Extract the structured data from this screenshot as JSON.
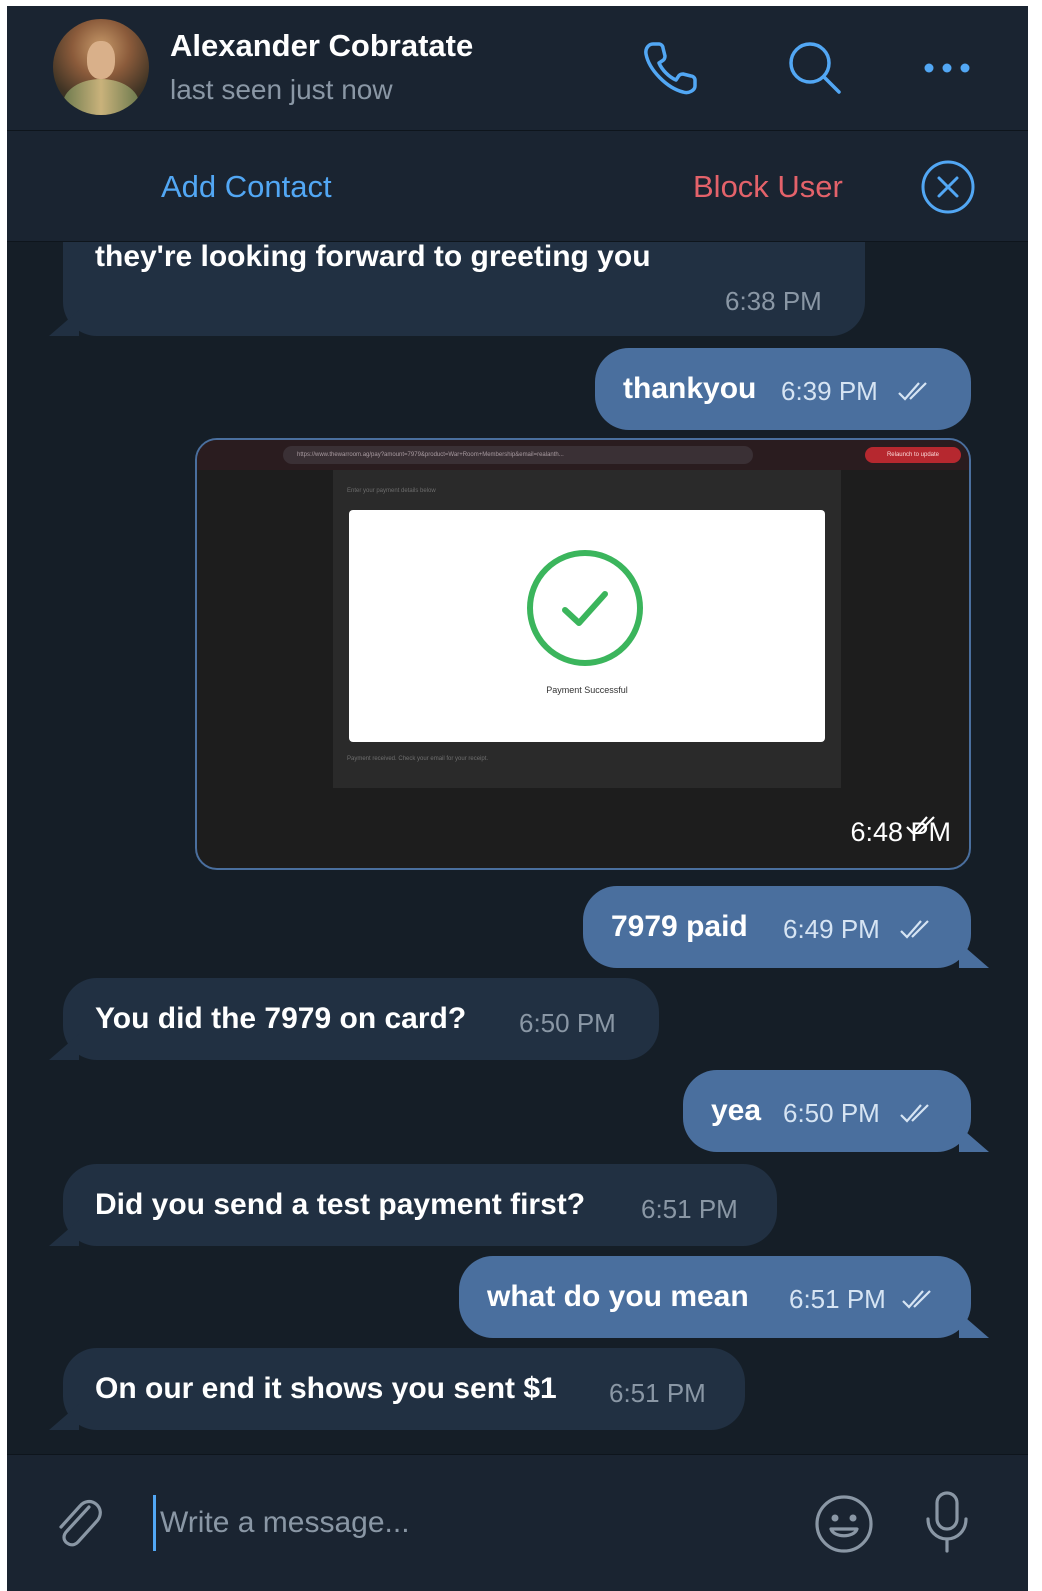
{
  "header": {
    "name": "Alexander Cobratate",
    "status": "last seen just now"
  },
  "actionbar": {
    "add_contact": "Add Contact",
    "block_user": "Block User"
  },
  "messages": [
    {
      "dir": "in",
      "text": "they're looking forward to greeting you",
      "time": "6:38 PM"
    },
    {
      "dir": "out",
      "text": "thankyou",
      "time": "6:39 PM"
    },
    {
      "dir": "out",
      "type": "image",
      "time": "6:48 PM",
      "image": {
        "url": "https://www.thewarroom.ag/pay?amount=7979&product=War+Room+Membership&email=realanth...",
        "relaunch": "Relaunch to update",
        "top_text": "Enter your payment details below",
        "card_text": "Payment Successful",
        "bottom_text": "Payment received. Check your email for your receipt."
      }
    },
    {
      "dir": "out",
      "text": "7979 paid",
      "time": "6:49 PM"
    },
    {
      "dir": "in",
      "text": "You did the 7979 on card?",
      "time": "6:50 PM"
    },
    {
      "dir": "out",
      "text": "yea",
      "time": "6:50 PM"
    },
    {
      "dir": "in",
      "text": "Did you send a test payment first?",
      "time": "6:51 PM"
    },
    {
      "dir": "out",
      "text": "what do you mean",
      "time": "6:51 PM"
    },
    {
      "dir": "in",
      "text": "On our end it shows you sent $1",
      "time": "6:51 PM"
    }
  ],
  "composer": {
    "placeholder": "Write a message..."
  },
  "colors": {
    "accent": "#52a7f4",
    "danger": "#e3626a",
    "outgoing_bubble": "#4a6f9e",
    "incoming_bubble": "#213042"
  },
  "icons": [
    "phone-icon",
    "search-icon",
    "more-icon",
    "close-icon",
    "attach-icon",
    "emoji-icon",
    "microphone-icon",
    "double-check-icon"
  ]
}
